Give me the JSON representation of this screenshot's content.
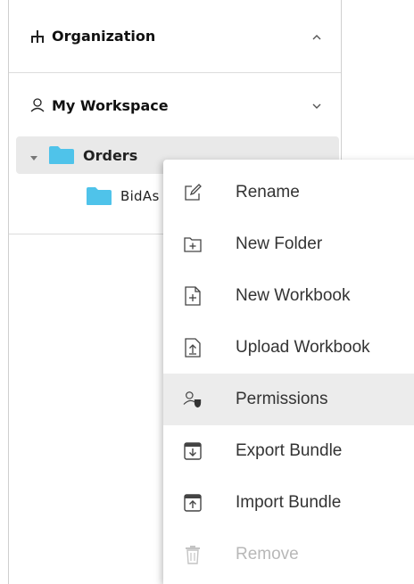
{
  "sidebar": {
    "organization": {
      "label": "Organization",
      "icon": "hierarchy-icon",
      "state": "collapsed-chevron-up"
    },
    "workspace": {
      "label": "My Workspace",
      "icon": "user-icon",
      "state": "chevron-down"
    },
    "tree": [
      {
        "label": "Orders",
        "icon": "folder-icon",
        "expanded": true,
        "selected": true
      },
      {
        "label": "BidAs",
        "icon": "folder-icon",
        "level": 2
      }
    ]
  },
  "context_menu": {
    "items": [
      {
        "label": "Rename",
        "icon": "edit-icon",
        "state": "normal"
      },
      {
        "label": "New Folder",
        "icon": "new-folder-icon",
        "state": "normal"
      },
      {
        "label": "New Workbook",
        "icon": "new-workbook-icon",
        "state": "normal"
      },
      {
        "label": "Upload Workbook",
        "icon": "upload-workbook-icon",
        "state": "normal"
      },
      {
        "label": "Permissions",
        "icon": "permissions-icon",
        "state": "highlighted"
      },
      {
        "label": "Export Bundle",
        "icon": "export-bundle-icon",
        "state": "normal"
      },
      {
        "label": "Import Bundle",
        "icon": "import-bundle-icon",
        "state": "normal"
      },
      {
        "label": "Remove",
        "icon": "trash-icon",
        "state": "disabled"
      }
    ]
  },
  "colors": {
    "folder": "#4fc3ea",
    "selected_row": "#e9e9e9",
    "highlight": "#ececec",
    "disabled_text": "#b8b8b8"
  }
}
